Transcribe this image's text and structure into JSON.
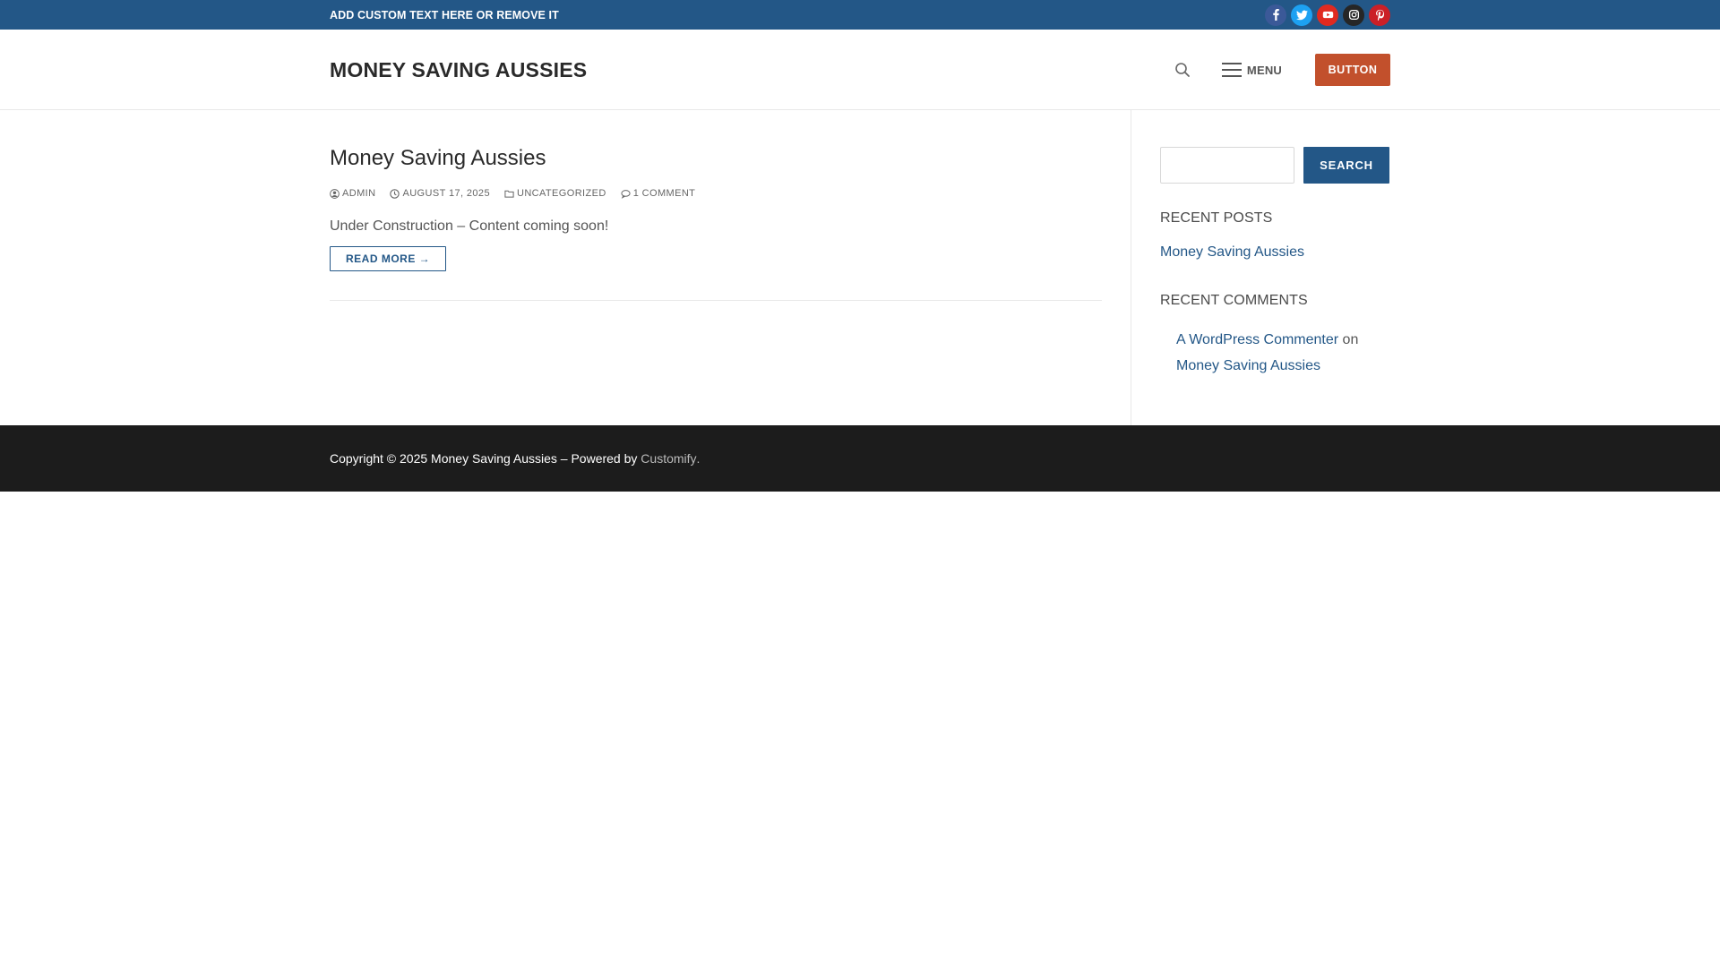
{
  "topbar": {
    "custom_text": "ADD CUSTOM TEXT HERE OR REMOVE IT",
    "social_icons": [
      {
        "name": "facebook-icon",
        "color": "#3b5998"
      },
      {
        "name": "twitter-icon",
        "color": "#1da1f2"
      },
      {
        "name": "youtube-icon",
        "color": "#e02a20"
      },
      {
        "name": "instagram-icon",
        "color": "#262626"
      },
      {
        "name": "pinterest-icon",
        "color": "#cb2027"
      }
    ]
  },
  "header": {
    "site_title": "MONEY SAVING AUSSIES",
    "menu_label": "MENU",
    "button_label": "BUTTON",
    "button_color": "#c2502c"
  },
  "post": {
    "title": "Money Saving Aussies",
    "meta": {
      "author": "ADMIN",
      "date": "AUGUST 17, 2025",
      "category": "UNCATEGORIZED",
      "comments": "1 COMMENT"
    },
    "excerpt": "Under Construction – Content coming soon!",
    "read_more": "READ MORE →"
  },
  "sidebar": {
    "search_placeholder": "",
    "search_button": "SEARCH",
    "recent_posts_title": "RECENT POSTS",
    "recent_posts": [
      "Money Saving Aussies"
    ],
    "recent_comments_title": "RECENT COMMENTS",
    "recent_comments": [
      {
        "author": "A WordPress Commenter",
        "connector": "on",
        "post": "Money Saving Aussies"
      }
    ]
  },
  "footer": {
    "copyright": "Copyright © 2025 Money Saving Aussies – Powered by",
    "powered_link": "Customify",
    "period": "."
  },
  "colors": {
    "primary": "#235787",
    "footer_bg": "#1c1c1c",
    "accent": "#c2502c"
  }
}
